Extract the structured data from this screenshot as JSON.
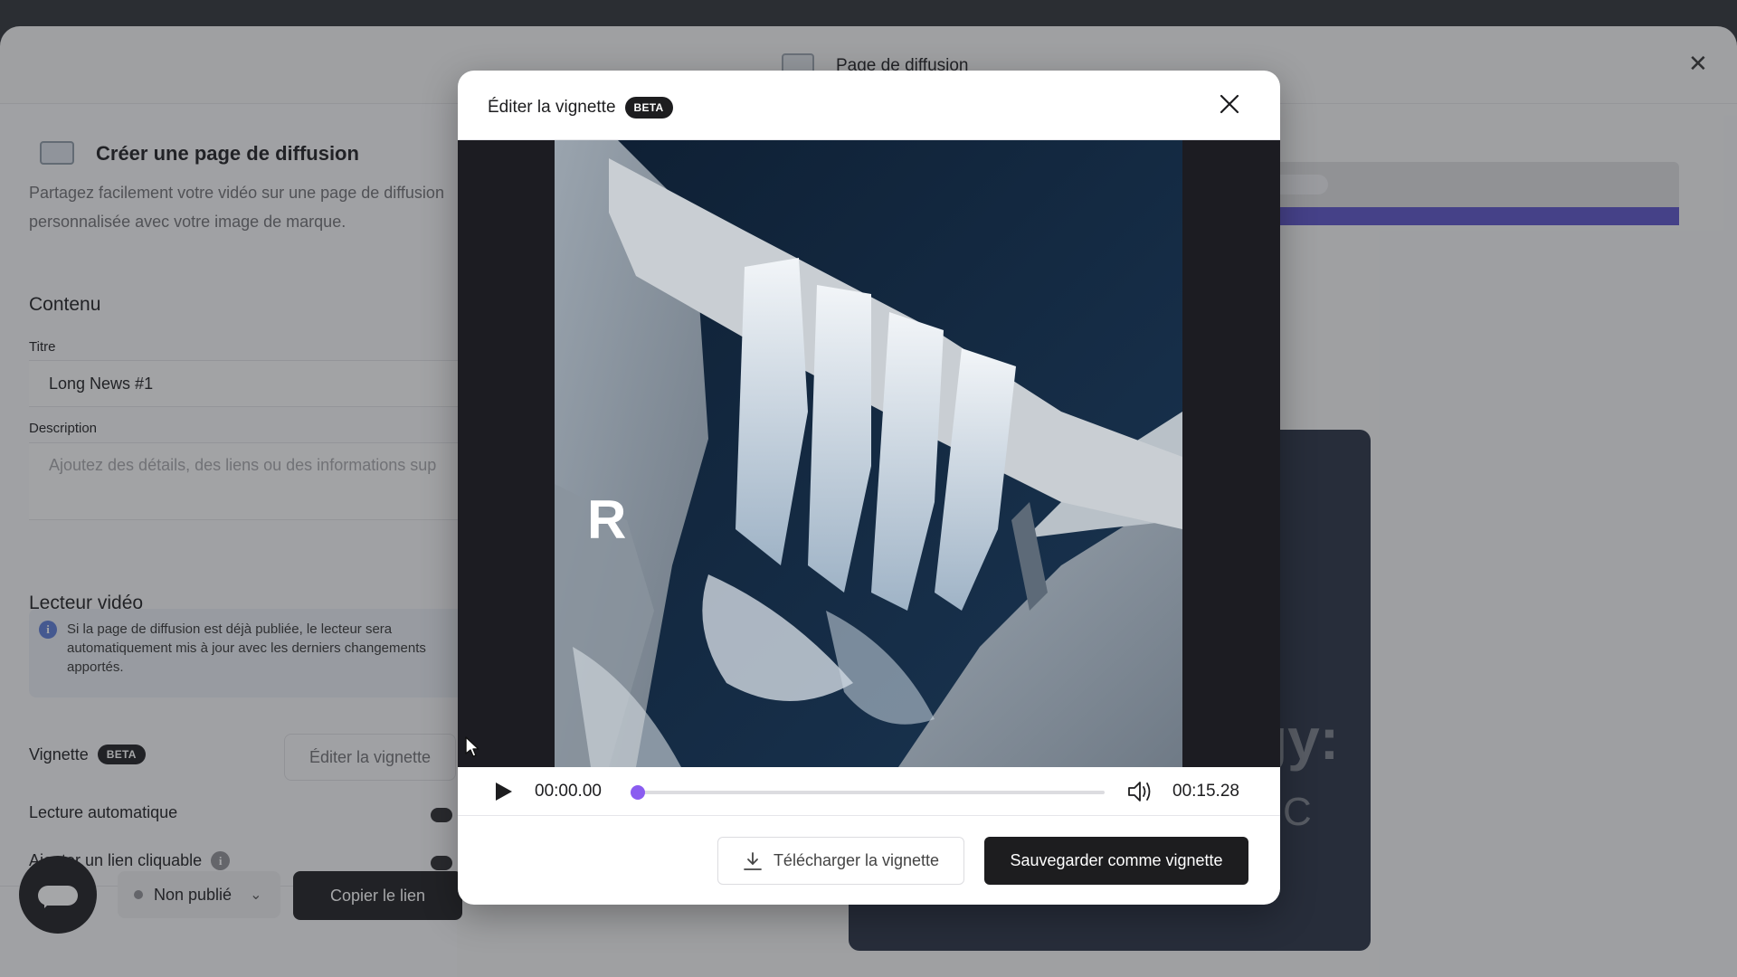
{
  "app_header": {
    "title": "Page de diffusion"
  },
  "left_panel": {
    "title": "Créer une page de diffusion",
    "intro": "Partagez facilement votre vidéo sur une page de diffusion personnalisée avec votre image de marque.",
    "content_section": "Contenu",
    "title_label": "Titre",
    "title_value": "Long News #1",
    "description_label": "Description",
    "description_placeholder": "Ajoutez des détails, des liens ou des informations sup",
    "player_section": "Lecteur vidéo",
    "info_text": "Si la page de diffusion est déjà publiée, le lecteur sera automatiquement mis à jour avec les derniers changements apportés.",
    "thumbnail_label": "Vignette",
    "thumbnail_badge": "BETA",
    "edit_thumbnail_button": "Éditer la vignette",
    "autoplay_label": "Lecture automatique",
    "clickable_link_label": "Ajouter un lien cliquable",
    "status_value": "Non publié",
    "copy_link_button": "Copier le lien"
  },
  "preview": {
    "title_fragment": "gy:",
    "subtitle_fragment": "C"
  },
  "modal": {
    "title": "Éditer la vignette",
    "badge": "BETA",
    "watermark": "R",
    "time_current": "00:00.00",
    "time_total": "00:15.28",
    "progress": 0.0,
    "download_button": "Télécharger la vignette",
    "save_button": "Sauvegarder comme vignette"
  },
  "colors": {
    "accent": "#8a5cf0",
    "primary_dark": "#1d1d1f",
    "info_blue": "#5b7ad6",
    "preview_accent": "#5b52c9"
  },
  "icons": {
    "close": "close-icon",
    "play": "play-icon",
    "volume": "volume-icon",
    "download": "download-icon",
    "info": "info-icon",
    "help": "help-icon",
    "chevron": "chevron-down-icon",
    "chat": "chat-icon"
  }
}
